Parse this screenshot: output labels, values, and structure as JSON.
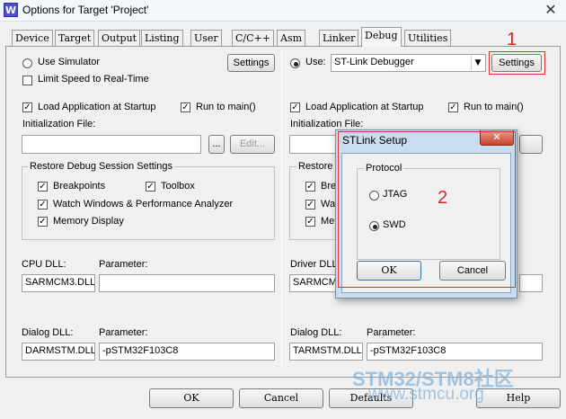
{
  "window": {
    "title": "Options for Target 'Project'",
    "app_icon": "W",
    "close_glyph": "✕"
  },
  "tabs": [
    {
      "label": "Device"
    },
    {
      "label": "Target"
    },
    {
      "label": "Output"
    },
    {
      "label": "Listing"
    },
    {
      "label": "User"
    },
    {
      "label": "C/C++"
    },
    {
      "label": "Asm"
    },
    {
      "label": "Linker"
    },
    {
      "label": "Debug",
      "active": true
    },
    {
      "label": "Utilities"
    }
  ],
  "left": {
    "use_simulator": "Use Simulator",
    "settings": "Settings",
    "limit_speed": "Limit Speed to Real-Time",
    "load_app": "Load Application at Startup",
    "run_to_main": "Run to main()",
    "init_file": "Initialization File:",
    "browse": "...",
    "edit": "Edit...",
    "restore_group": "Restore Debug Session Settings",
    "breakpoints": "Breakpoints",
    "toolbox": "Toolbox",
    "watch_windows": "Watch Windows & Performance Analyzer",
    "memory_display": "Memory Display",
    "cpu_dll_label": "CPU DLL:",
    "param_label": "Parameter:",
    "cpu_dll_value": "SARMCM3.DLL",
    "cpu_param_value": "",
    "dialog_dll_label": "Dialog DLL:",
    "dialog_dll_value": "DARMSTM.DLL",
    "dialog_param_value": "-pSTM32F103C8"
  },
  "right": {
    "use_label": "Use:",
    "debugger": "ST-Link Debugger",
    "settings": "Settings",
    "load_app": "Load Application at Startup",
    "run_to_main": "Run to main()",
    "init_file": "Initialization File:",
    "restore_prefix": "Restore",
    "bre": "Bre",
    "wa": "Wa",
    "me": "Me",
    "driver_dll_label": "Driver DLL",
    "driver_dll_value": "SARMCM",
    "dialog_dll_label": "Dialog DLL:",
    "param_label": "Parameter:",
    "dialog_dll_value": "TARMSTM.DLL",
    "dialog_param_value": "-pSTM32F103C8"
  },
  "annotations": {
    "one": "1",
    "two": "2"
  },
  "stlink_dialog": {
    "title": "STLink Setup",
    "close_glyph": "✕",
    "protocol_label": "Protocol",
    "jtag": "JTAG",
    "swd": "SWD",
    "selected": "SWD",
    "ok": "OK",
    "cancel": "Cancel"
  },
  "bottom": {
    "ok": "OK",
    "cancel": "Cancel",
    "defaults": "Defaults",
    "help": "Help"
  },
  "watermark": {
    "line1": "STM32/STM8社区",
    "line2": "www.stmcu.org"
  },
  "colors": {
    "annotation_red": "#e02020",
    "watermark": "#7fb0d8"
  }
}
